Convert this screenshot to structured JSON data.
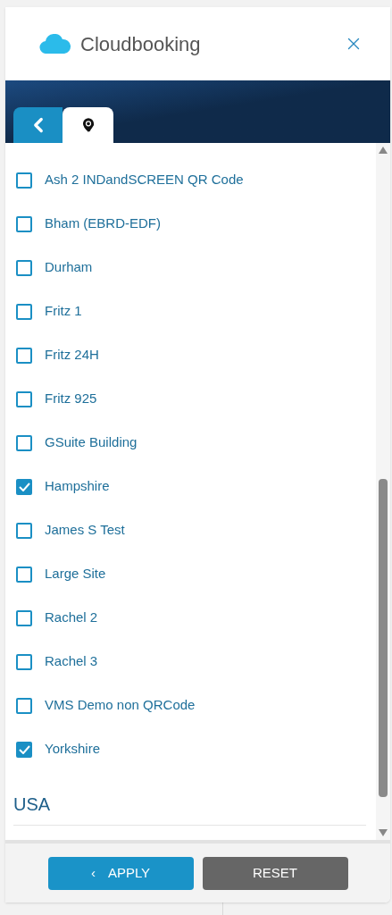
{
  "header": {
    "title": "Cloudbooking"
  },
  "sites": [
    {
      "label": "Ash 2 INDandSCREEN QR Code",
      "checked": false
    },
    {
      "label": "Bham (EBRD-EDF)",
      "checked": false
    },
    {
      "label": "Durham",
      "checked": false
    },
    {
      "label": "Fritz 1",
      "checked": false
    },
    {
      "label": "Fritz 24H",
      "checked": false
    },
    {
      "label": "Fritz 925",
      "checked": false
    },
    {
      "label": "GSuite Building",
      "checked": false
    },
    {
      "label": "Hampshire",
      "checked": true
    },
    {
      "label": "James S Test",
      "checked": false
    },
    {
      "label": "Large Site",
      "checked": false
    },
    {
      "label": "Rachel 2",
      "checked": false
    },
    {
      "label": "Rachel 3",
      "checked": false
    },
    {
      "label": "VMS Demo non QRCode",
      "checked": false
    },
    {
      "label": "Yorkshire",
      "checked": true
    }
  ],
  "group_heading": "USA",
  "buttons": [
    {
      "kind": "apply",
      "label": "APPLY",
      "icon": "‹"
    },
    {
      "kind": "reset",
      "label": "RESET"
    }
  ]
}
